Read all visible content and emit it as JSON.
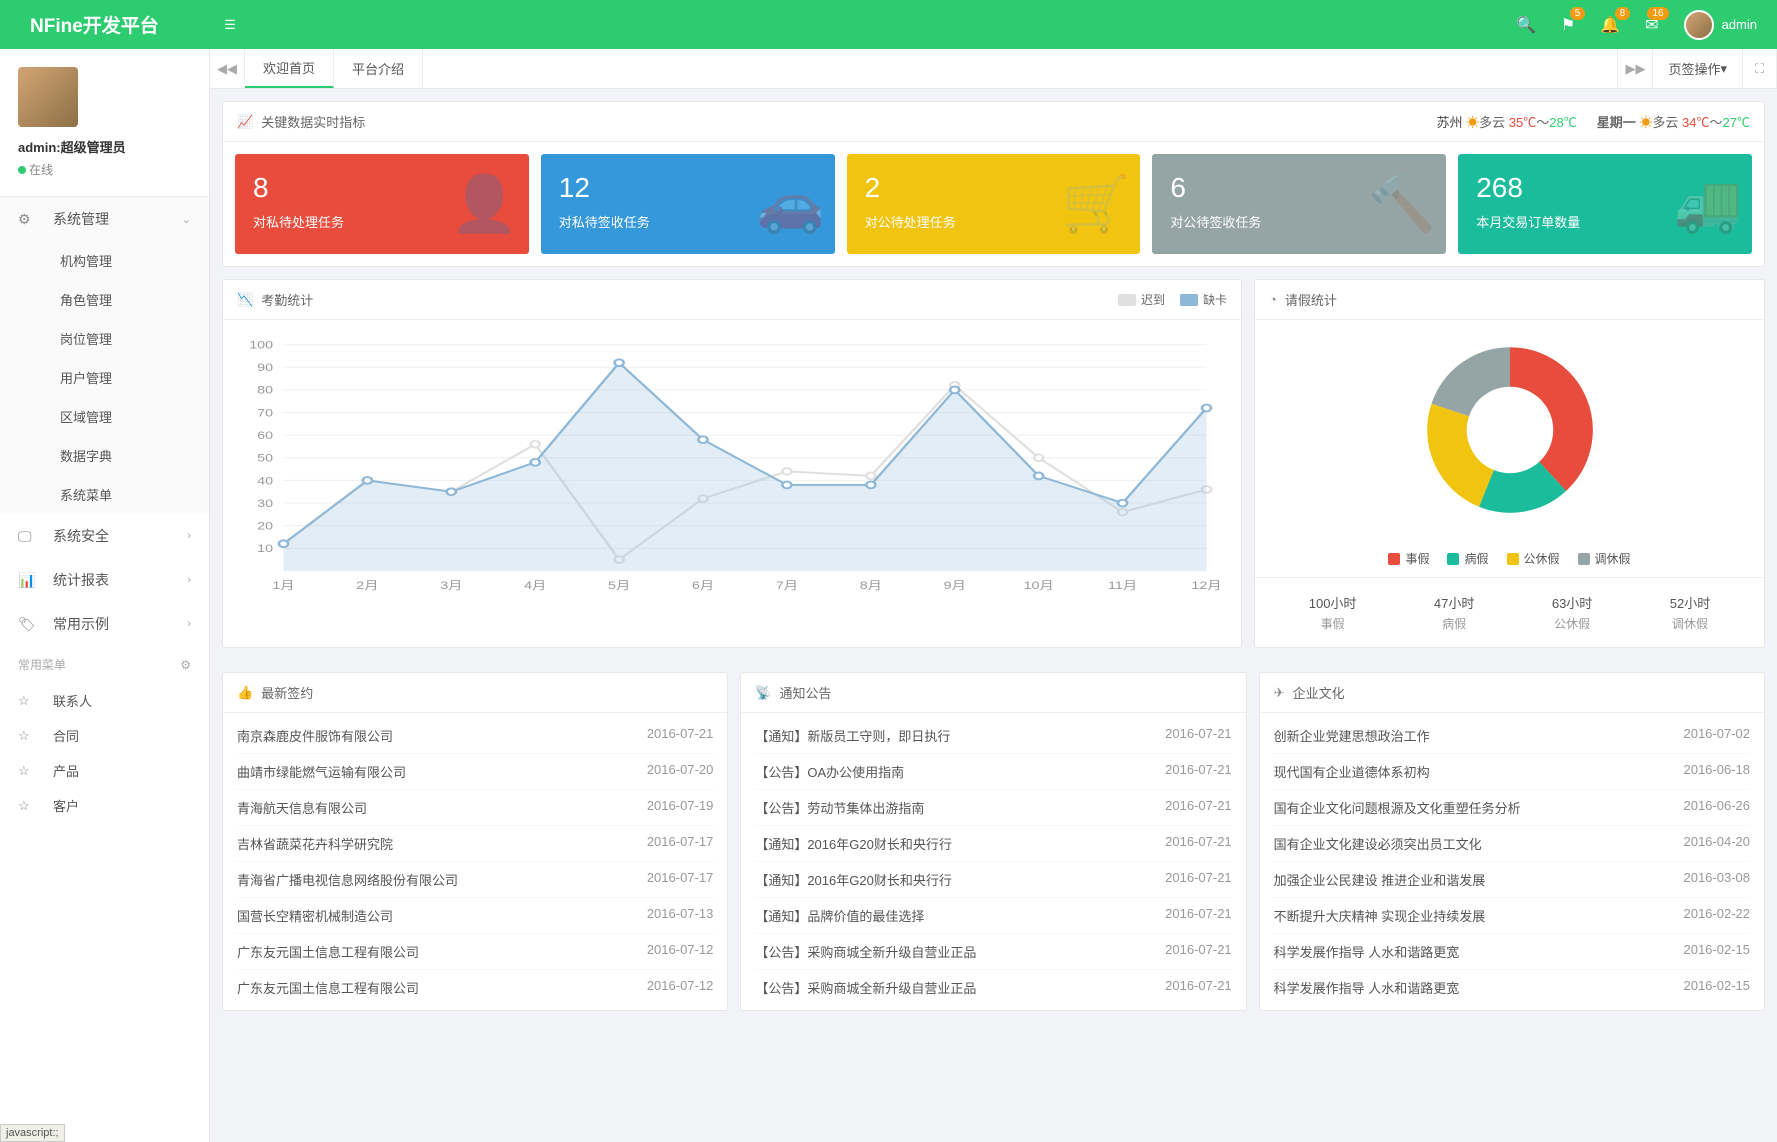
{
  "header": {
    "logo": "NFine开发平台",
    "badges": {
      "flag": "5",
      "bell": "8",
      "mail": "16"
    },
    "username": "admin"
  },
  "sidebar": {
    "user": {
      "name": "admin:超级管理员",
      "status": "在线"
    },
    "menu": {
      "sys_mgmt": "系统管理",
      "sys_mgmt_items": [
        "机构管理",
        "角色管理",
        "岗位管理",
        "用户管理",
        "区域管理",
        "数据字典",
        "系统菜单"
      ],
      "sys_security": "系统安全",
      "stats": "统计报表",
      "examples": "常用示例"
    },
    "fav_header": "常用菜单",
    "favorites": [
      "联系人",
      "合同",
      "产品",
      "客户"
    ]
  },
  "tabs": {
    "t1": "欢迎首页",
    "t2": "平台介绍",
    "ops": "页签操作"
  },
  "realtime": {
    "title": "关键数据实时指标",
    "weather1": {
      "city": "苏州",
      "cond": "多云",
      "hi": "35℃",
      "lo": "28℃"
    },
    "weather2": {
      "day": "星期一",
      "cond": "多云",
      "hi": "34℃",
      "lo": "27℃"
    },
    "stats": [
      {
        "num": "8",
        "label": "对私待处理任务"
      },
      {
        "num": "12",
        "label": "对私待签收任务"
      },
      {
        "num": "2",
        "label": "对公待处理任务"
      },
      {
        "num": "6",
        "label": "对公待签收任务"
      },
      {
        "num": "268",
        "label": "本月交易订单数量"
      }
    ]
  },
  "attendance": {
    "title": "考勤统计",
    "legend": {
      "l1": "迟到",
      "l2": "缺卡"
    }
  },
  "leave": {
    "title": "请假统计",
    "legend": [
      "事假",
      "病假",
      "公休假",
      "调休假"
    ],
    "colors": [
      "#e74c3c",
      "#1abc9c",
      "#f1c40f",
      "#95a5a6"
    ],
    "stats": [
      {
        "val": "100小时",
        "label": "事假"
      },
      {
        "val": "47小时",
        "label": "病假"
      },
      {
        "val": "63小时",
        "label": "公休假"
      },
      {
        "val": "52小时",
        "label": "调休假"
      }
    ]
  },
  "signings": {
    "title": "最新签约",
    "items": [
      {
        "t": "南京森鹿皮件服饰有限公司",
        "d": "2016-07-21"
      },
      {
        "t": "曲靖市绿能燃气运输有限公司",
        "d": "2016-07-20"
      },
      {
        "t": "青海航天信息有限公司",
        "d": "2016-07-19"
      },
      {
        "t": "吉林省蔬菜花卉科学研究院",
        "d": "2016-07-17"
      },
      {
        "t": "青海省广播电视信息网络股份有限公司",
        "d": "2016-07-17"
      },
      {
        "t": "国营长空精密机械制造公司",
        "d": "2016-07-13"
      },
      {
        "t": "广东友元国土信息工程有限公司",
        "d": "2016-07-12"
      },
      {
        "t": "广东友元国土信息工程有限公司",
        "d": "2016-07-12"
      }
    ]
  },
  "notices": {
    "title": "通知公告",
    "items": [
      {
        "t": "【通知】新版员工守则，即日执行",
        "d": "2016-07-21"
      },
      {
        "t": "【公告】OA办公使用指南",
        "d": "2016-07-21"
      },
      {
        "t": "【公告】劳动节集体出游指南",
        "d": "2016-07-21"
      },
      {
        "t": "【通知】2016年G20财长和央行行",
        "d": "2016-07-21"
      },
      {
        "t": "【通知】2016年G20财长和央行行",
        "d": "2016-07-21"
      },
      {
        "t": "【通知】品牌价值的最佳选择",
        "d": "2016-07-21"
      },
      {
        "t": "【公告】采购商城全新升级自营业正品",
        "d": "2016-07-21"
      },
      {
        "t": "【公告】采购商城全新升级自营业正品",
        "d": "2016-07-21"
      }
    ]
  },
  "culture": {
    "title": "企业文化",
    "items": [
      {
        "t": "创新企业党建思想政治工作",
        "d": "2016-07-02"
      },
      {
        "t": "现代国有企业道德体系初构",
        "d": "2016-06-18"
      },
      {
        "t": "国有企业文化问题根源及文化重塑任务分析",
        "d": "2016-06-26"
      },
      {
        "t": "国有企业文化建设必须突出员工文化",
        "d": "2016-04-20"
      },
      {
        "t": "加强企业公民建设 推进企业和谐发展",
        "d": "2016-03-08"
      },
      {
        "t": "不断提升大庆精神 实现企业持续发展",
        "d": "2016-02-22"
      },
      {
        "t": "科学发展作指导 人水和谐路更宽",
        "d": "2016-02-15"
      },
      {
        "t": "科学发展作指导 人水和谐路更宽",
        "d": "2016-02-15"
      }
    ]
  },
  "chart_data": {
    "type": "line",
    "categories": [
      "1月",
      "2月",
      "3月",
      "4月",
      "5月",
      "6月",
      "7月",
      "8月",
      "9月",
      "10月",
      "11月",
      "12月"
    ],
    "ylim": [
      0,
      100
    ],
    "yticks": [
      10,
      20,
      30,
      40,
      50,
      60,
      70,
      80,
      90,
      100
    ],
    "series": [
      {
        "name": "迟到",
        "color": "#e0e0e0",
        "values": [
          12,
          40,
          35,
          56,
          5,
          32,
          44,
          42,
          82,
          50,
          26,
          36
        ]
      },
      {
        "name": "缺卡",
        "color": "#8fb8d8",
        "fill": true,
        "values": [
          12,
          40,
          35,
          48,
          92,
          58,
          38,
          38,
          80,
          42,
          30,
          72
        ]
      }
    ],
    "donut": {
      "type": "pie",
      "series": [
        {
          "name": "事假",
          "value": 100
        },
        {
          "name": "病假",
          "value": 47
        },
        {
          "name": "公休假",
          "value": 63
        },
        {
          "name": "调休假",
          "value": 52
        }
      ]
    }
  },
  "status": "javascript:;"
}
